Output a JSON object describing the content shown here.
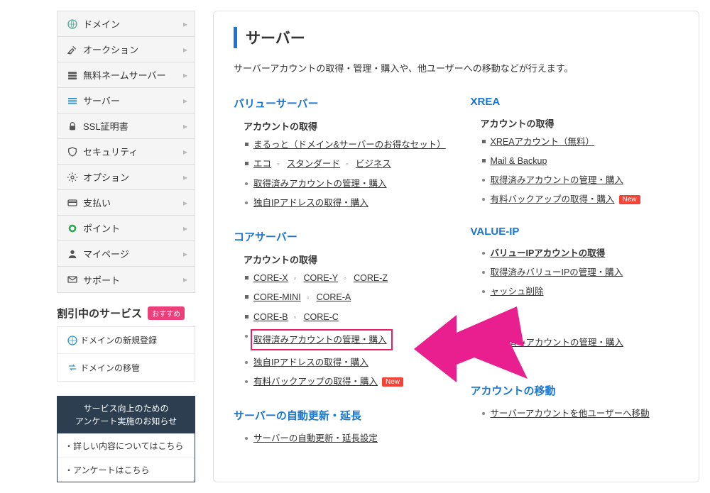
{
  "sidebar": {
    "nav": [
      {
        "icon": "domain",
        "label": "ドメイン"
      },
      {
        "icon": "auction",
        "label": "オークション"
      },
      {
        "icon": "ns",
        "label": "無料ネームサーバー"
      },
      {
        "icon": "server",
        "label": "サーバー"
      },
      {
        "icon": "ssl",
        "label": "SSL証明書"
      },
      {
        "icon": "security",
        "label": "セキュリティ"
      },
      {
        "icon": "option",
        "label": "オプション"
      },
      {
        "icon": "payment",
        "label": "支払い"
      },
      {
        "icon": "point",
        "label": "ポイント"
      },
      {
        "icon": "mypage",
        "label": "マイページ"
      },
      {
        "icon": "support",
        "label": "サポート"
      }
    ],
    "promo": {
      "title": "割引中のサービス",
      "badge": "おすすめ",
      "items": [
        {
          "icon": "domain",
          "label": "ドメインの新規登録"
        },
        {
          "icon": "transfer",
          "label": "ドメインの移管"
        }
      ]
    },
    "survey": {
      "line1": "サービス向上のための",
      "line2": "アンケート実施のお知らせ",
      "links": [
        "・詳しい内容についてはこちら",
        "・アンケートはこちら"
      ]
    }
  },
  "main": {
    "title": "サーバー",
    "desc": "サーバーアカウントの取得・管理・購入や、他ユーザーへの移動などが行えます。",
    "col1": {
      "s1": {
        "title": "バリューサーバー",
        "heading": "アカウントの取得",
        "row1": "まるっと（ドメイン&サーバーのお得なセット）",
        "row2": [
          "エコ",
          "スタンダード",
          "ビジネス"
        ],
        "row3": "取得済みアカウントの管理・購入",
        "row4": "独自IPアドレスの取得・購入"
      },
      "s2": {
        "title": "コアサーバー",
        "heading": "アカウントの取得",
        "row1": [
          "CORE-X",
          "CORE-Y",
          "CORE-Z"
        ],
        "row2": [
          "CORE-MINI",
          "CORE-A"
        ],
        "row3": [
          "CORE-B",
          "CORE-C"
        ],
        "row4": "取得済みアカウントの管理・購入",
        "row5": "独自IPアドレスの取得・購入",
        "row6": "有料バックアップの取得・購入",
        "new": "New"
      },
      "s3": {
        "title": "サーバーの自動更新・延長",
        "row1": "サーバーの自動更新・延長設定"
      }
    },
    "col2": {
      "s1": {
        "title": "XREA",
        "heading": "アカウントの取得",
        "row1": "XREAアカウント（無料）",
        "row2": "Mail & Backup",
        "row3": "取得済みアカウントの管理・購入",
        "row4": "有料バックアップの取得・購入",
        "new": "New"
      },
      "s2": {
        "title": "VALUE-IP",
        "row1": "バリューIPアカウントの取得",
        "row2": "取得済みバリューIPの管理・購入",
        "row3": "ャッシュ削除",
        "row4": "取得済みアカウントの管理・購入"
      },
      "s3": {
        "title": "アカウントの移動",
        "row1": "サーバーアカウントを他ユーザーへ移動"
      }
    }
  }
}
